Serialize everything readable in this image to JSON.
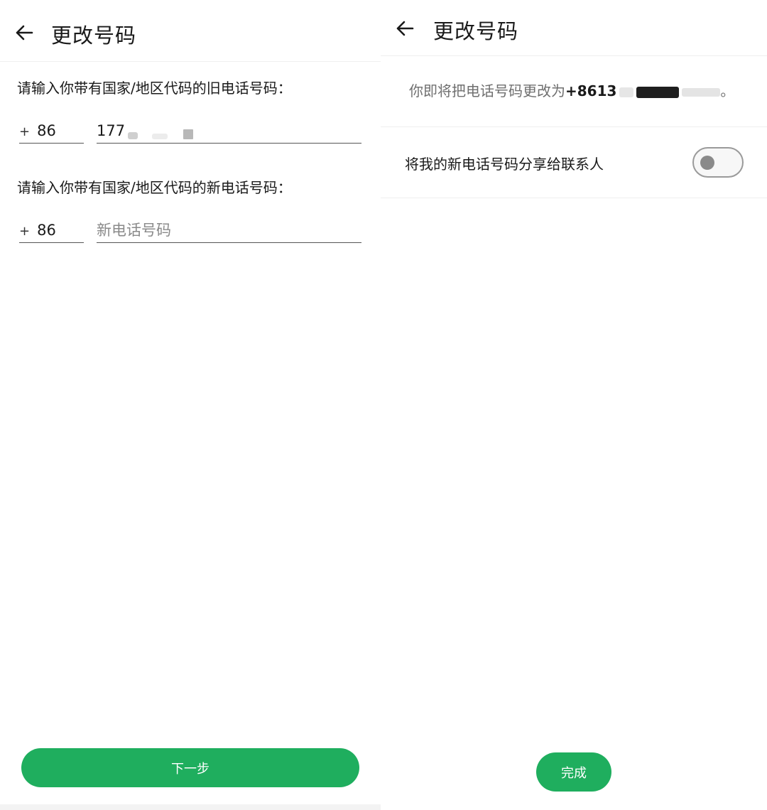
{
  "left": {
    "title": "更改号码",
    "old_prompt": "请输入你带有国家/地区代码的旧电话号码：",
    "old_country_code": "86",
    "old_phone_value": "177",
    "new_prompt": "请输入你带有国家/地区代码的新电话号码：",
    "new_country_code": "86",
    "new_phone_placeholder": "新电话号码",
    "next_label": "下一步",
    "plus_sign": "+"
  },
  "right": {
    "title": "更改号码",
    "notice_prefix": "你即将把电话号码更改为",
    "notice_number": "+8613",
    "notice_suffix": "。",
    "share_label": "将我的新电话号码分享给联系人",
    "share_enabled": false,
    "done_label": "完成"
  },
  "colors": {
    "accent": "#1fae5e",
    "text_primary": "#1a1a1a",
    "text_secondary": "#6f6f6f"
  },
  "icons": {
    "back": "arrow-left-icon"
  }
}
